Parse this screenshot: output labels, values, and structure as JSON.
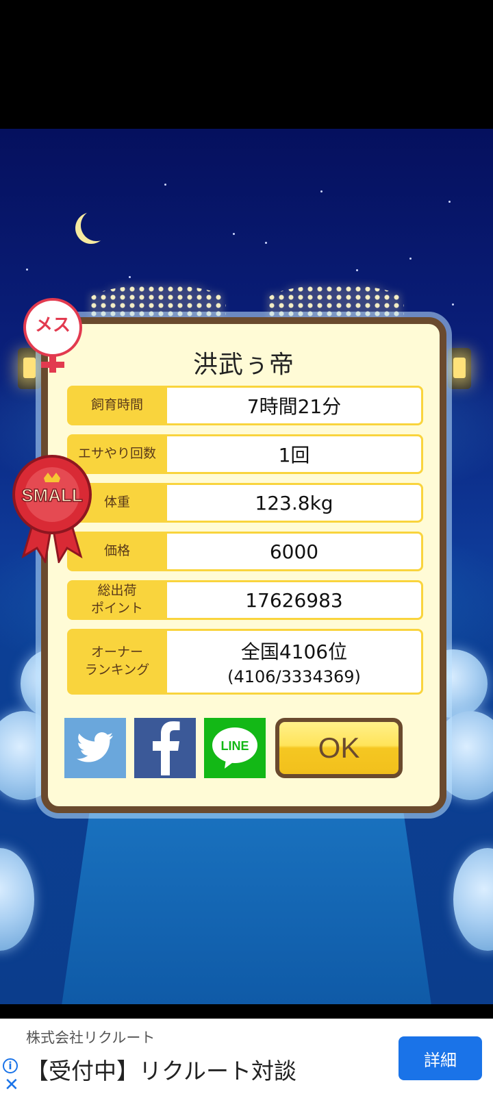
{
  "dialog": {
    "title": "洪武ぅ帝",
    "stats": [
      {
        "label": "飼育時間",
        "value": "7時間21分"
      },
      {
        "label": "エサやり回数",
        "value": "1回"
      },
      {
        "label": "体重",
        "value": "123.8kg"
      },
      {
        "label": "価格",
        "value": "6000"
      },
      {
        "label": "総出荷\nポイント",
        "value": "17626983"
      },
      {
        "label": "オーナー\nランキング",
        "value": "全国4106位",
        "sub": "(4106/3334369)"
      }
    ],
    "ok_label": "OK",
    "line_label": "LINE"
  },
  "badges": {
    "gender": "メス",
    "size": "SMALL"
  },
  "ad": {
    "company": "株式会社リクルート",
    "headline": "【受付中】リクルート対談",
    "button": "詳細"
  },
  "colors": {
    "panel_border": "#6a4a2e",
    "label_bg": "#f9d43d",
    "twitter": "#6aa7dc",
    "facebook": "#3b5998",
    "line": "#13b816",
    "ad_button": "#1a73e8"
  }
}
